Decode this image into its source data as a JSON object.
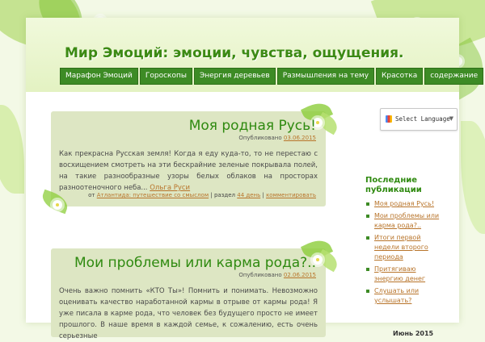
{
  "site": {
    "title": "Мир Эмоций: эмоции, чувства, ощущения."
  },
  "nav": {
    "items": [
      {
        "label": "Марафон Эмоций"
      },
      {
        "label": "Гороскопы"
      },
      {
        "label": "Энергия деревьев"
      },
      {
        "label": "Размышления на тему"
      },
      {
        "label": "Красотка"
      },
      {
        "label": "содержание"
      }
    ]
  },
  "posts": [
    {
      "title": "Моя родная Русь!",
      "published_label": "Опубликовано",
      "date": "03.06.2015",
      "excerpt": "Как прекрасна Русская земля! Когда я еду куда-то, то не перестаю с восхищением смотреть на эти бескрайние зеленые покрывала полей, на такие разнообразные узоры белых облаков на просторах разноотеночного неба...",
      "read_more": "Ольга Руси",
      "footer_prefix": "от",
      "author": "Атлантида: путешествие со смыслом",
      "section_label": "раздел",
      "section": "44 день",
      "comments": "комментировать"
    },
    {
      "title": "Мои проблемы или карма рода?..",
      "published_label": "Опубликовано",
      "date": "02.06.2015",
      "excerpt": "Очень важно помнить «КТО Ты»! Помнить и понимать. Невозможно оценивать качество наработанной кармы в отрыве от кармы рода! Я уже писала в карме рода, что человек без будущего просто не имеет прошлого. В наше время в каждой семье, к сожалению, есть очень серьезные"
    }
  ],
  "sidebar": {
    "language": {
      "label": "Select Language",
      "caret": "▼"
    },
    "recent": {
      "title": "Последние публикации",
      "items": [
        "Моя родная Русь!",
        "Мои проблемы или карма рода?..",
        "Итоги первой недели второго периода",
        "Притягиваю энергию денег",
        "Слушать или услышать?"
      ]
    },
    "calendar": {
      "title": "Июнь 2015"
    }
  },
  "colors": {
    "accent": "#3d8b25",
    "title_green": "#2f8a10",
    "link": "#b8742a",
    "post_bg": "#dde6c3"
  }
}
